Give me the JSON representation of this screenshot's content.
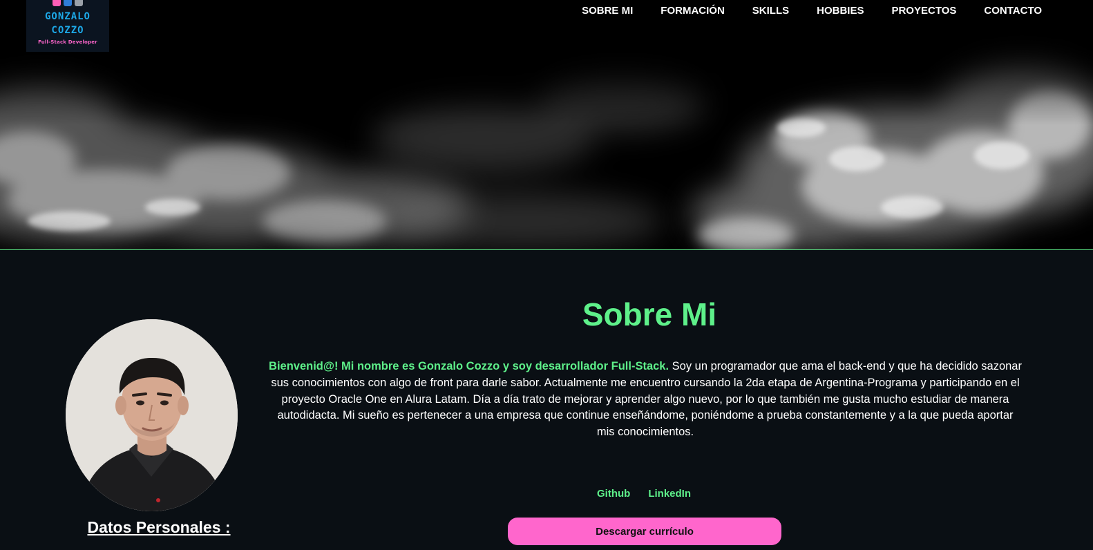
{
  "colors": {
    "accent": "#5ef08a",
    "button": "#ff66cc",
    "background": "#0a0f14",
    "header": "#000000",
    "logo_text": "#1da9e8"
  },
  "logo": {
    "line1": "GONZALO",
    "line2": "COZZO",
    "subtitle": "Full-Stack Developer"
  },
  "nav": {
    "items": [
      {
        "label": "SOBRE MI"
      },
      {
        "label": "FORMACIÓN"
      },
      {
        "label": "SKILLS"
      },
      {
        "label": "HOBBIES"
      },
      {
        "label": "PROYECTOS"
      },
      {
        "label": "CONTACTO"
      }
    ]
  },
  "about": {
    "title": "Sobre Mi",
    "intro": "Bienvenid@! Mi nombre es Gonzalo Cozzo y soy desarrollador Full-Stack.",
    "body": " Soy un programador que ama el back-end y que ha decidido sazonar sus conocimientos con algo de front para darle sabor. Actualmente me encuentro cursando la 2da etapa de Argentina-Programa y participando en el proyecto Oracle One en Alura Latam. Día a día trato de mejorar y aprender algo nuevo, por lo que también me gusta mucho estudiar de manera autodidacta. Mi sueño es pertenecer a una empresa que continue enseñándome, poniéndome a prueba constantemente y a la que pueda aportar mis conocimientos.",
    "links": {
      "github": "Github",
      "linkedin": "LinkedIn"
    },
    "cv_button": "Descargar currículo",
    "personal_data_title": "Datos Personales :"
  }
}
